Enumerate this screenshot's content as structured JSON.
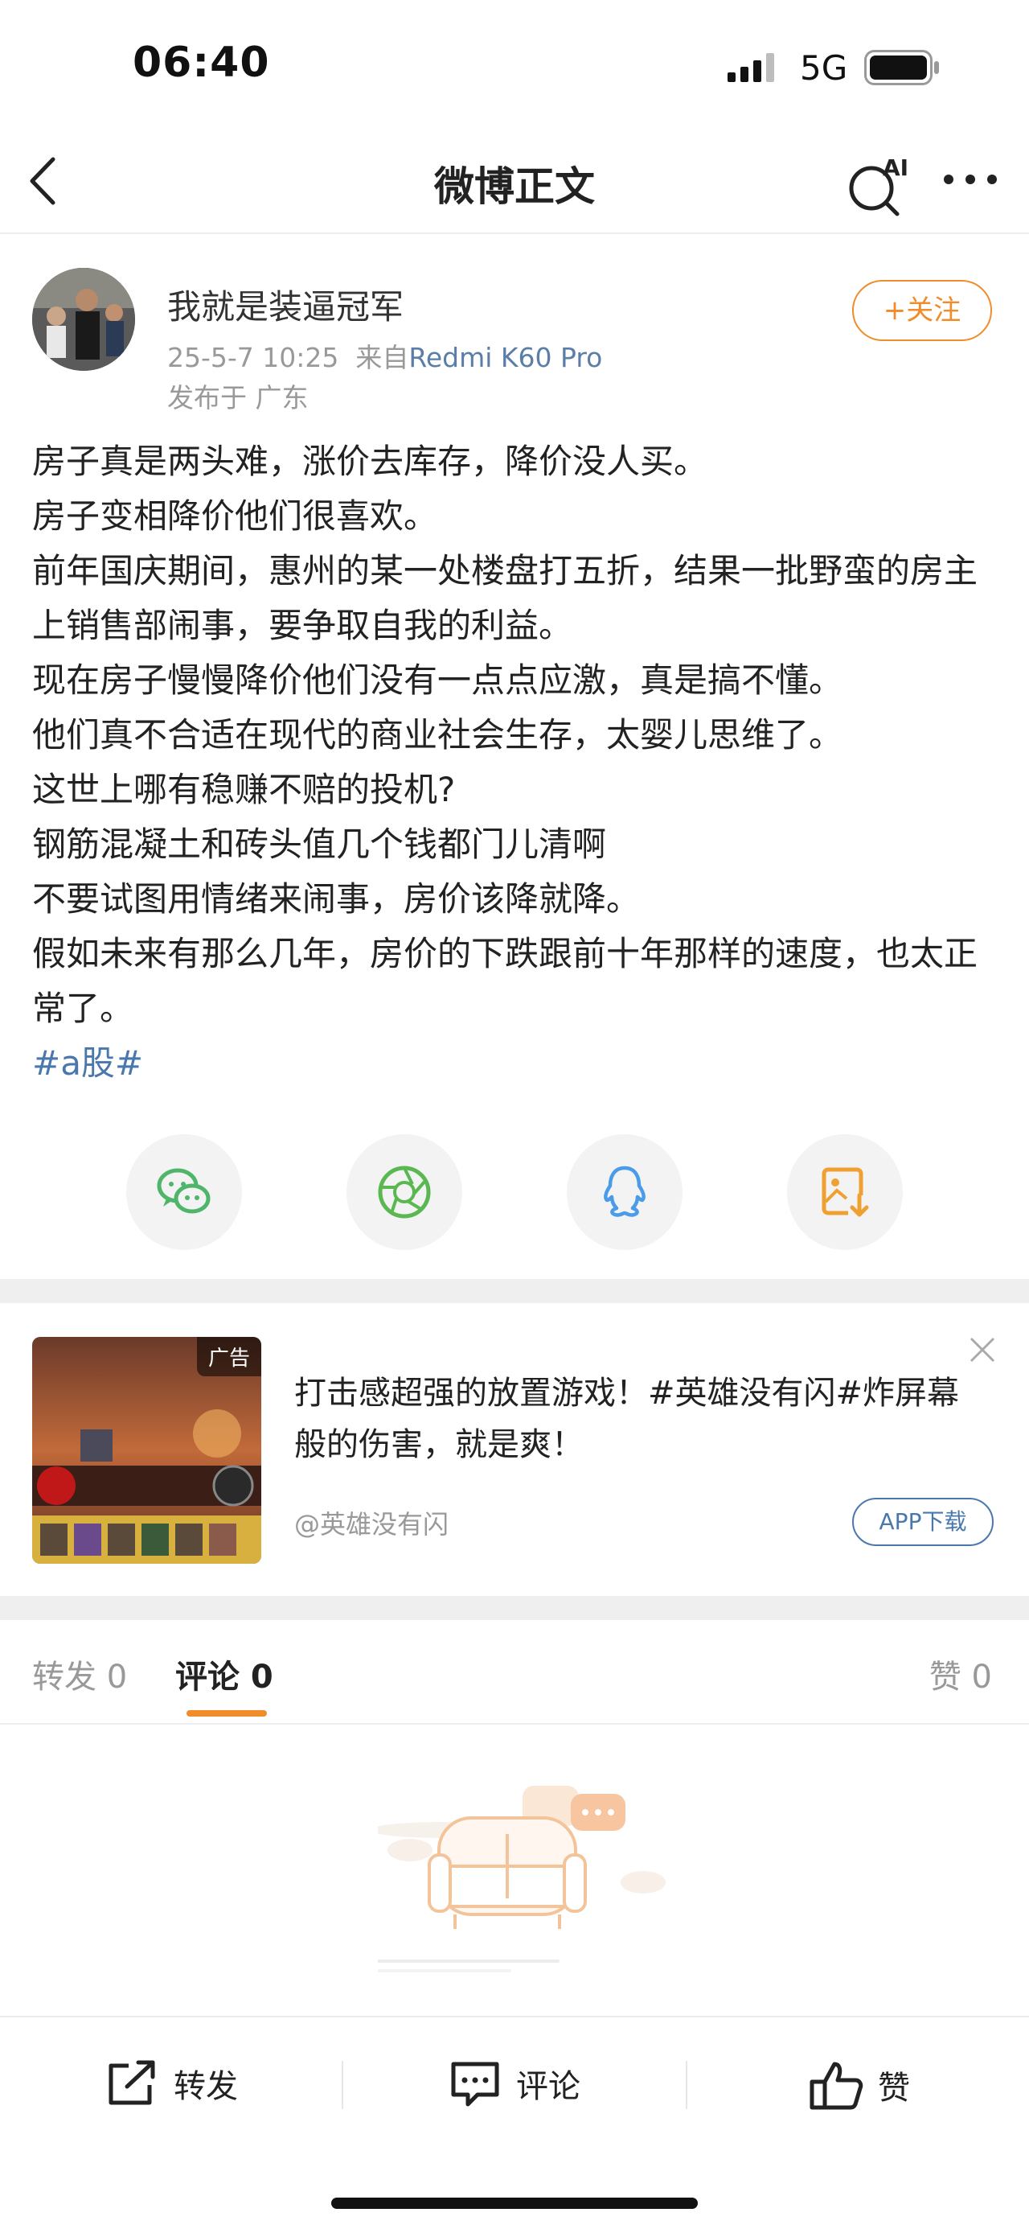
{
  "status_bar": {
    "time": "06:40",
    "network": "5G"
  },
  "nav": {
    "title": "微博正文",
    "ai_label": "AI"
  },
  "post": {
    "author": "我就是装逼冠军",
    "date": "25-5-7 10:25",
    "source_prefix": "来自",
    "device": "Redmi K60 Pro",
    "location": "发布于 广东",
    "follow_label": "+关注",
    "lines": [
      "房子真是两头难，涨价去库存，降价没人买。",
      "房子变相降价他们很喜欢。",
      "前年国庆期间，惠州的某一处楼盘打五折，结果一批野蛮的房主上销售部闹事，要争取自我的利益。",
      "现在房子慢慢降价他们没有一点点应激，真是搞不懂。",
      "他们真不合适在现代的商业社会生存，太婴儿思维了。",
      "这世上哪有稳赚不赔的投机?",
      "钢筋混凝土和砖头值几个钱都门儿清啊",
      "不要试图用情绪来闹事，房价该降就降。",
      "假如未来有那么几年，房价的下跌跟前十年那样的速度，也太正常了。"
    ],
    "hashtag": "#a股#"
  },
  "share": {
    "icons": [
      "wechat-icon",
      "moments-icon",
      "qq-icon",
      "save-image-icon"
    ],
    "colors": {
      "wechat": "#4fb56b",
      "moments": "#59b84f",
      "qq": "#4a9be8",
      "save": "#f0a030"
    }
  },
  "ad": {
    "badge": "广告",
    "text": "打击感超强的放置游戏！#英雄没有闪#炸屏幕般的伤害，就是爽！",
    "account": "@英雄没有闪",
    "button": "APP下载"
  },
  "tabs": {
    "repost": "转发 0",
    "comments": "评论 0",
    "likes": "赞 0"
  },
  "bottom_bar": {
    "repost": "转发",
    "comment": "评论",
    "like": "赞"
  },
  "colors": {
    "accent": "#f08c2a",
    "link": "#4a78ad"
  }
}
